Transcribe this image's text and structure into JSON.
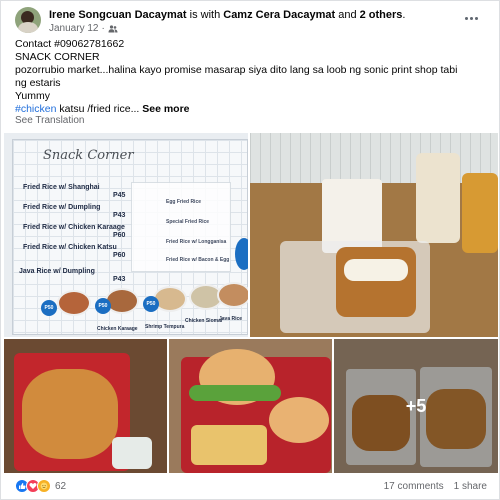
{
  "post": {
    "author": "Irene Songcuan Dacaymat",
    "with_text": "is with",
    "tagged": "Camz Cera Dacaymat",
    "and_text": "and",
    "others": "2 others",
    "period": ".",
    "date": "January 12",
    "separator": "·",
    "privacy_icon": "friends-icon",
    "more_icon": "more-options-icon",
    "lines": {
      "l1": "Contact #09062781662",
      "l2": " SNACK CORNER",
      "l3": "pozorrubio market...halina kayo promise masarap siya dito lang sa loob ng sonic print shop tabi",
      "l4": "ng estaris",
      "l5": "Yummy",
      "l6_hashtag": "#chicken",
      "l6_rest": " katsu /fried rice...",
      "see_more": "See more"
    },
    "see_translation": "See Translation"
  },
  "menu_board": {
    "title": "Snack Corner",
    "items": [
      {
        "name": "Fried Rice w/ Shanghai",
        "price": "P45"
      },
      {
        "name": "Fried Rice w/ Dumpling",
        "price": "P43"
      },
      {
        "name": "Fried Rice w/ Chicken Karaage",
        "price": "P60"
      },
      {
        "name": "Fried Rice w/ Chicken Katsu",
        "price": "P60"
      },
      {
        "name": "Java Rice w/ Dumpling",
        "price": "P43"
      }
    ],
    "sub_items": [
      "Egg Fried Rice",
      "Special Fried Rice",
      "Fried Rice w/ Longganisa",
      "Fried Rice w/ Bacon & Egg"
    ],
    "badges": [
      "P50",
      "P50",
      "P50"
    ],
    "captions": [
      "Chicken Karaage",
      "Shrimp Tempura",
      "Chicken Siomai",
      "Java Rice"
    ]
  },
  "photos": {
    "more_count": "+5"
  },
  "footer": {
    "reaction_count": "62",
    "comments": "17 comments",
    "shares": "1 share",
    "reaction_icons": [
      "like-icon",
      "love-icon",
      "care-icon"
    ]
  },
  "colors": {
    "link": "#216fdb",
    "secondary_text": "#65676b",
    "like": "#1877f2",
    "love": "#f33e58",
    "care": "#f7b125",
    "menu_blue": "#1b6ec2"
  }
}
